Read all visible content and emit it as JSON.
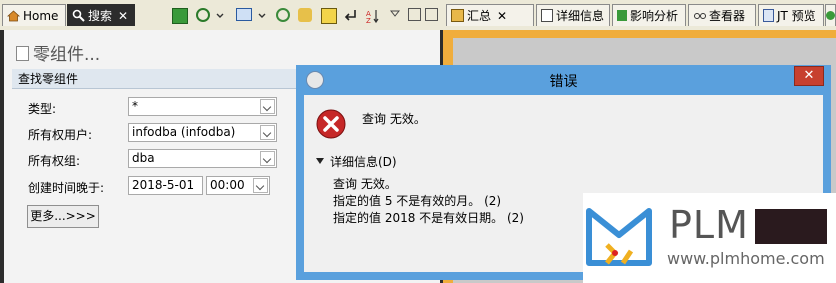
{
  "tabs": {
    "home": "Home",
    "search": "搜索",
    "summary": "汇总",
    "details": "详细信息",
    "impact": "影响分析",
    "viewer": "查看器",
    "jt_preview": "JT 预览"
  },
  "panel": {
    "title": "零组件...",
    "section": "查找零组件",
    "fields": {
      "type_label": "类型:",
      "type_value": "*",
      "owner_user_label": "所有权用户:",
      "owner_user_value": "infodba (infodba)",
      "owner_group_label": "所有权组:",
      "owner_group_value": "dba",
      "created_after_label": "创建时间晚于:",
      "created_after_date": "2018-5-01",
      "created_after_time": "00:00"
    },
    "more_button": "更多...>>>"
  },
  "dialog": {
    "title": "错误",
    "close": "✕",
    "message": "查询  无效。",
    "details_toggle": "详细信息(D)",
    "details_lines": [
      "查询  无效。",
      "指定的值 5 不是有效的月。 (2)",
      "指定的值 2018 不是有效日期。 (2)"
    ]
  },
  "watermark": {
    "brand": "PLM",
    "url": "www.plmhome.com"
  },
  "colors": {
    "dialog_frame": "#5aa0dd",
    "close_button": "#c7402f",
    "error_icon": "#c62828",
    "active_tab": "#2c2c2c",
    "right_accent": "#f0ad3c"
  }
}
